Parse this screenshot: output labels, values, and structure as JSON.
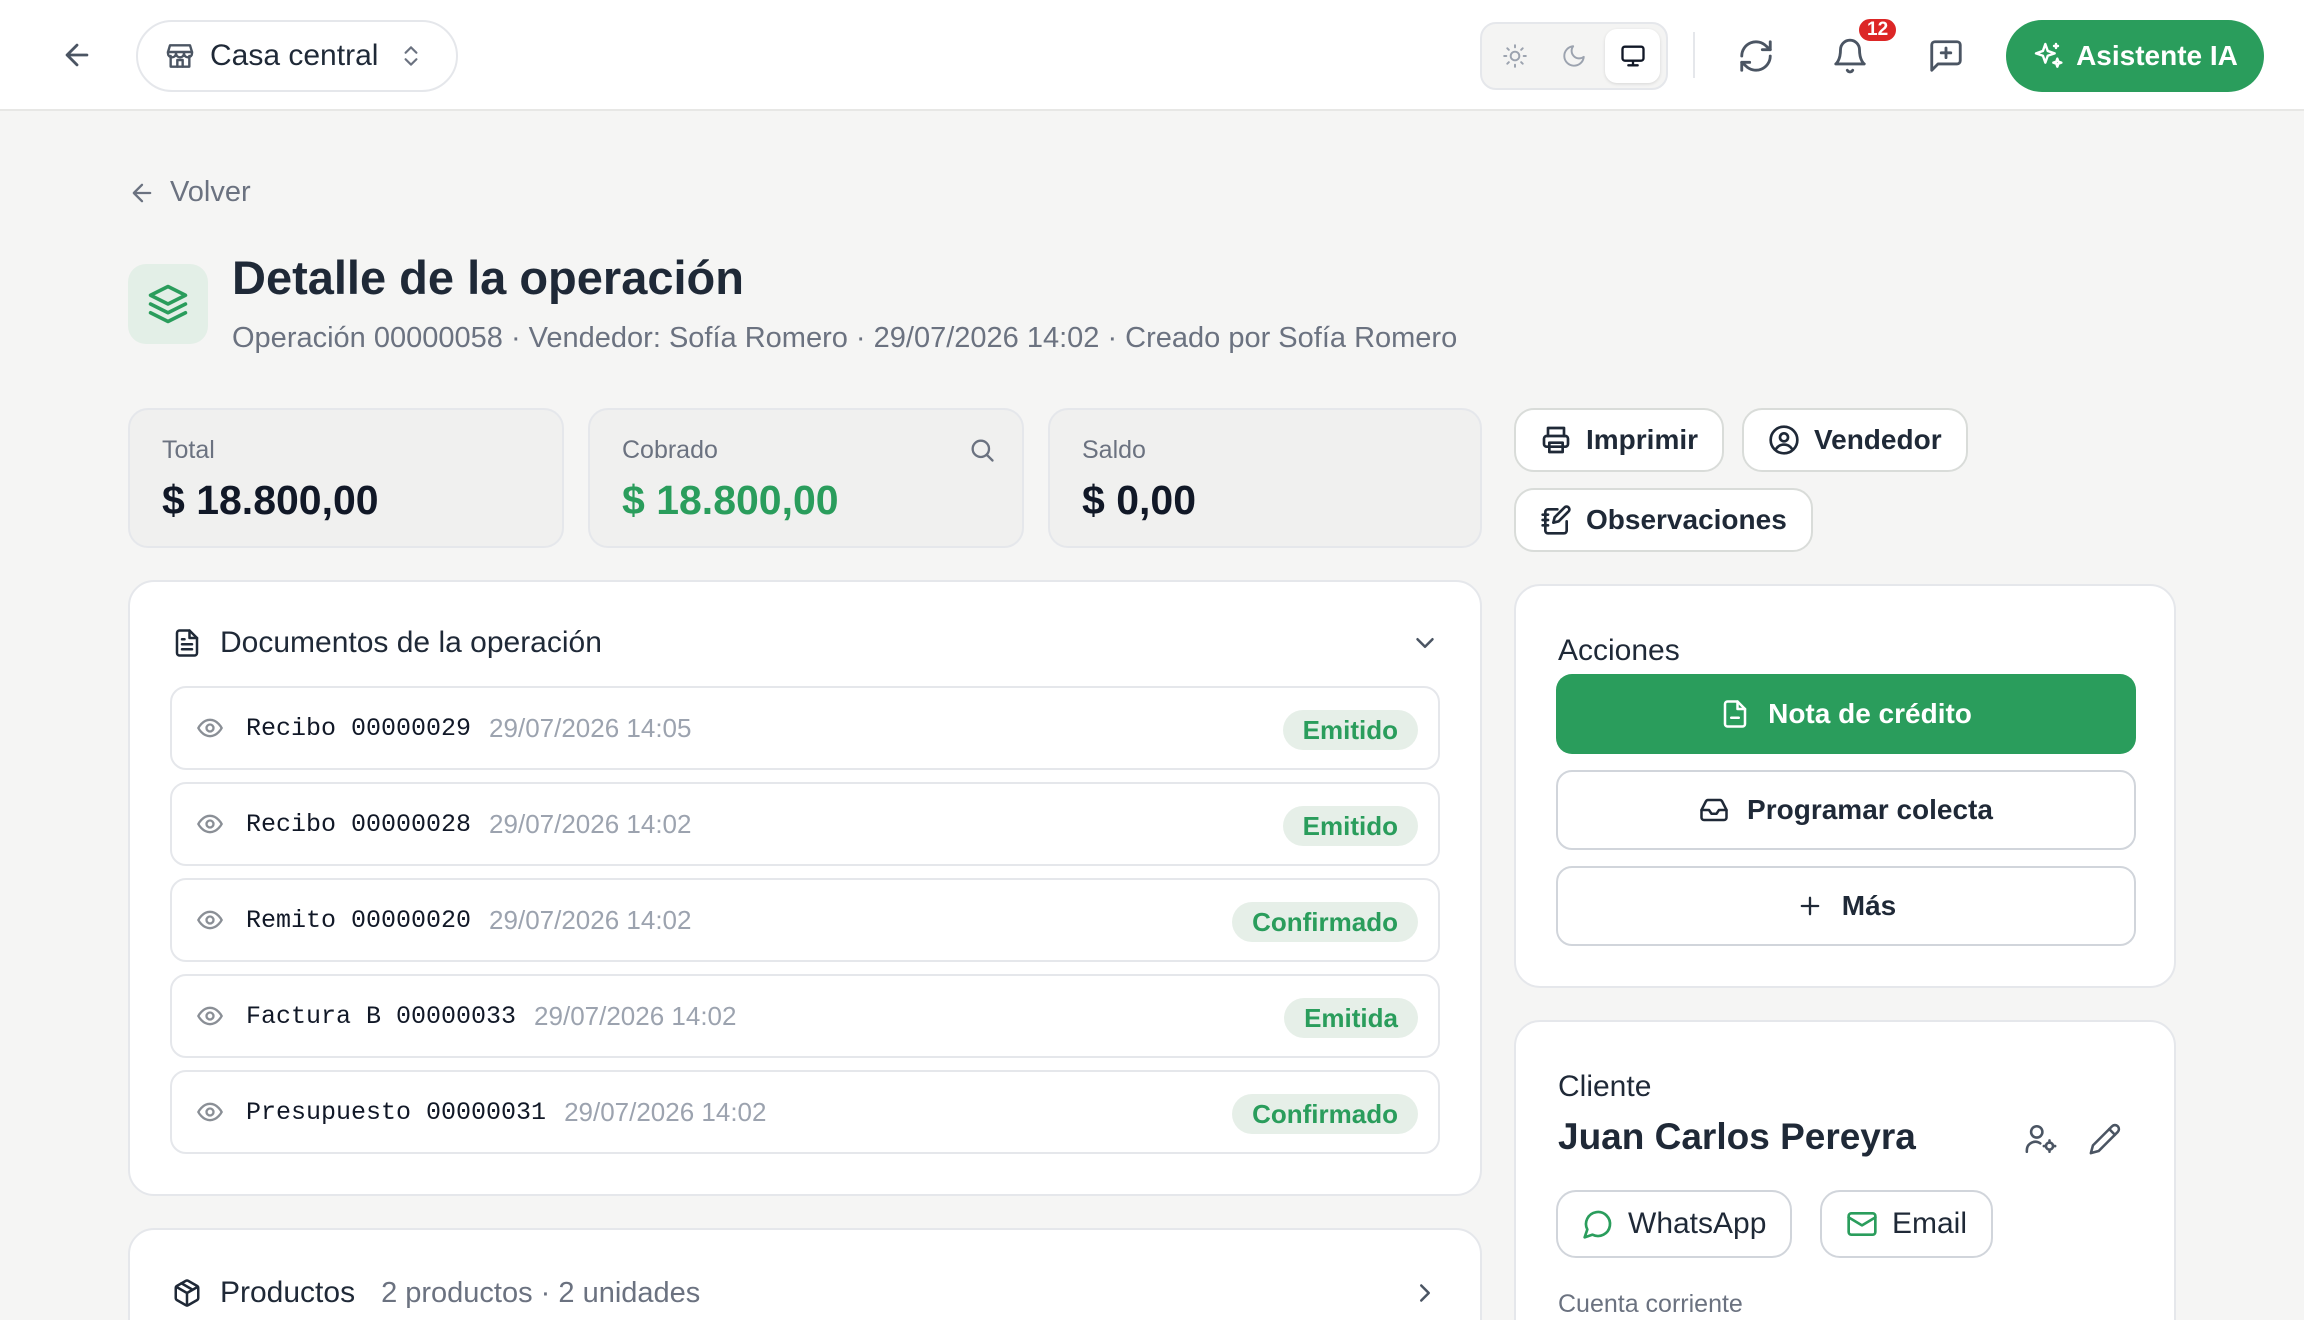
{
  "topbar": {
    "branch_label": "Casa central",
    "notifications_count": "12",
    "ai_button_label": "Asistente IA"
  },
  "page": {
    "back_label": "Volver",
    "title": "Detalle de la operación",
    "subtitle": "Operación 00000058 · Vendedor: Sofía Romero · 29/07/2026 14:02 · Creado por Sofía Romero"
  },
  "stats": {
    "total": {
      "label": "Total",
      "value": "$ 18.800,00"
    },
    "cobrado": {
      "label": "Cobrado",
      "value": "$ 18.800,00"
    },
    "saldo": {
      "label": "Saldo",
      "value": "$ 0,00"
    }
  },
  "toolbar": {
    "print_label": "Imprimir",
    "seller_label": "Vendedor",
    "notes_label": "Observaciones"
  },
  "documents": {
    "title": "Documentos de la operación",
    "rows": [
      {
        "name": "Recibo 00000029",
        "date": "29/07/2026 14:05",
        "status": "Emitido"
      },
      {
        "name": "Recibo 00000028",
        "date": "29/07/2026 14:02",
        "status": "Emitido"
      },
      {
        "name": "Remito 00000020",
        "date": "29/07/2026 14:02",
        "status": "Confirmado"
      },
      {
        "name": "Factura B 00000033",
        "date": "29/07/2026 14:02",
        "status": "Emitida"
      },
      {
        "name": "Presupuesto 00000031",
        "date": "29/07/2026 14:02",
        "status": "Confirmado"
      }
    ]
  },
  "products": {
    "title": "Productos",
    "meta": "2 productos · 2 unidades"
  },
  "actions": {
    "title": "Acciones",
    "credit_note_label": "Nota de crédito",
    "schedule_label": "Programar colecta",
    "more_label": "Más"
  },
  "client": {
    "title": "Cliente",
    "name": "Juan Carlos Pereyra",
    "whatsapp_label": "WhatsApp",
    "email_label": "Email",
    "account_label": "Cuenta corriente"
  },
  "colors": {
    "accent": "#2a9d5c",
    "badge": "#dc2626",
    "status_bg": "#e6efe8"
  }
}
